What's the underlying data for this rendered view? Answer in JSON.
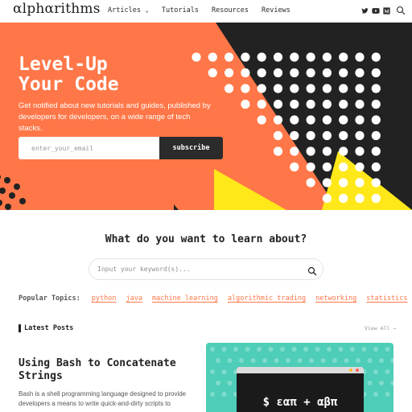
{
  "header": {
    "logo": "αlphαrithms",
    "nav": [
      {
        "label": "Articles",
        "suffix": "⌄"
      },
      {
        "label": "Tutorials",
        "suffix": ""
      },
      {
        "label": "Resources",
        "suffix": ""
      },
      {
        "label": "Reviews",
        "suffix": ""
      }
    ],
    "icons": [
      "twitter-icon",
      "youtube-icon",
      "medium-icon",
      "search-icon"
    ]
  },
  "hero": {
    "title_line1": "Level-Up",
    "title_line2": "Your Code",
    "description": "Get notified about new tutorials and guides, published by developers for developers, on a wide range of tech stacks.",
    "email_placeholder": "enter_your_email",
    "subscribe_label": "subscribe"
  },
  "learn": {
    "title": "What do you want to learn about?",
    "search_placeholder": "Input your keyword(s)...",
    "topics_label": "Popular Topics:",
    "topics": [
      "python",
      "java",
      "machine learning",
      "algorithmic trading",
      "networking",
      "statistics"
    ]
  },
  "latest": {
    "label": "Latest Posts",
    "view_all": "View All →",
    "post": {
      "title": "Using Bash to Concatenate Strings",
      "excerpt": "Bash is a shell programming language designed to provide developers a means to write quick-and-dirty scripts to",
      "thumb_text": "$ εαπ + αβπ"
    }
  },
  "colors": {
    "accent": "#ff7748",
    "dark": "#222222",
    "yellow": "#ffe81a",
    "thumb": "#4ecdb8"
  }
}
